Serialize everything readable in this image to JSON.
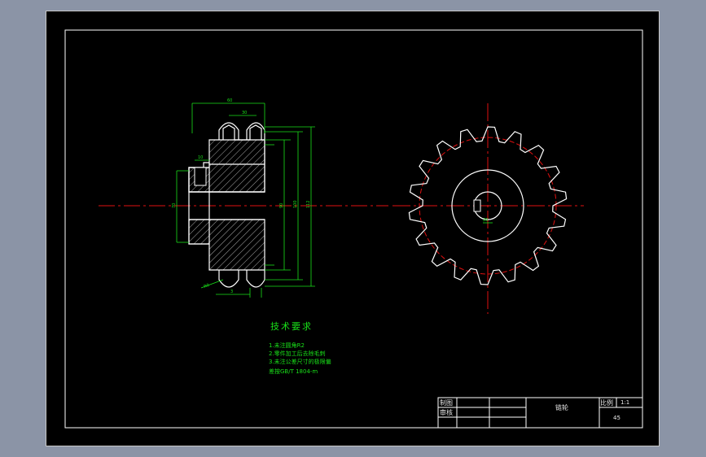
{
  "colors": {
    "background": "#8b94a6",
    "sheet": "#000000",
    "outline": "#ffffff",
    "dimension": "#19e019",
    "centerline": "#e01010",
    "hatch": "#d0d0d0"
  },
  "dimensions": {
    "overall_width": "60",
    "hub_width": "30",
    "groove_width": "10",
    "bore_dia": "70",
    "hub_dia": "90",
    "root_dia": "100",
    "tip_dia": "112",
    "keyway_width": "20",
    "angle_note": "R0",
    "bottom_small": "3"
  },
  "tech_requirements": {
    "title": "技术要求",
    "items": [
      "1.未注圆角R2",
      "2.零件加工后去除毛刺",
      "3.未注公差尺寸的极限偏",
      "差按GB/T 1804-m"
    ]
  },
  "title_block": {
    "drawn_label": "制图",
    "checked_label": "审核",
    "part_name": "链轮",
    "scale_label": "比例",
    "scale_value": "1:1",
    "material": "45"
  },
  "sprocket": {
    "teeth": 18
  }
}
